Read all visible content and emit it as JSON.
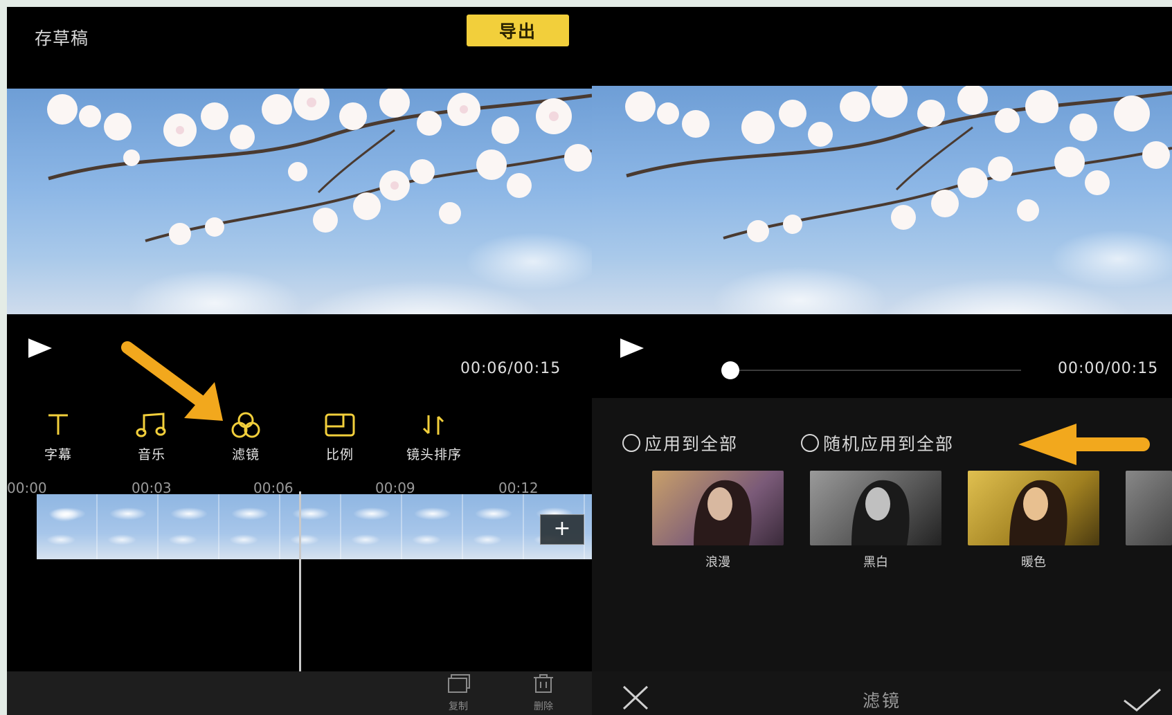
{
  "left": {
    "header": {
      "draft_label": "存草稿",
      "export_label": "导出"
    },
    "player": {
      "time": "00:06/00:15"
    },
    "toolbar": [
      {
        "label": "字幕",
        "icon": "text-icon"
      },
      {
        "label": "音乐",
        "icon": "music-note-icon"
      },
      {
        "label": "滤镜",
        "icon": "filter-circles-icon"
      },
      {
        "label": "比例",
        "icon": "aspect-ratio-icon"
      },
      {
        "label": "镜头排序",
        "icon": "sort-arrows-icon"
      }
    ],
    "ruler": [
      "00:00",
      "00:03",
      "00:06",
      "00:09",
      "00:12"
    ],
    "timeline": {
      "add_label": "+"
    },
    "bottom": {
      "copy_label": "复制",
      "delete_label": "删除"
    }
  },
  "right": {
    "player": {
      "time": "00:00/00:15",
      "progress": 0
    },
    "options": {
      "apply_all": "应用到全部",
      "random_apply_all": "随机应用到全部"
    },
    "filters": [
      {
        "label": "浪漫",
        "tint": "#8a6a4a"
      },
      {
        "label": "黑白",
        "tint": "#6a6a6a"
      },
      {
        "label": "暖色",
        "tint": "#a88a30"
      }
    ],
    "footer": {
      "title": "滤镜"
    }
  },
  "colors": {
    "accent": "#f2cf3b",
    "arrow": "#f2a81d",
    "background": "#000000"
  }
}
